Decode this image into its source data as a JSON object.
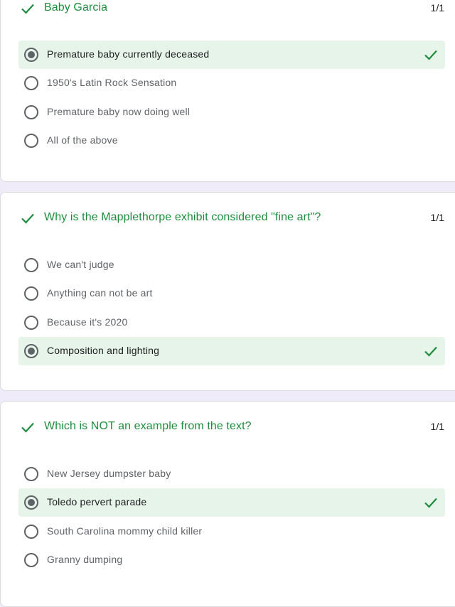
{
  "accent_color": "#1e8e3e",
  "correct_bg_color": "#e6f4ea",
  "questions": [
    {
      "title": "Baby Garcia",
      "score": "1/1",
      "options": [
        {
          "label": "Premature baby currently deceased",
          "selected": true,
          "correct": true
        },
        {
          "label": "1950's Latin Rock Sensation",
          "selected": false,
          "correct": false
        },
        {
          "label": "Premature baby now doing well",
          "selected": false,
          "correct": false
        },
        {
          "label": "All of the above",
          "selected": false,
          "correct": false
        }
      ]
    },
    {
      "title": "Why is the Mapplethorpe exhibit considered \"fine art\"?",
      "score": "1/1",
      "options": [
        {
          "label": "We can't judge",
          "selected": false,
          "correct": false
        },
        {
          "label": "Anything can not be art",
          "selected": false,
          "correct": false
        },
        {
          "label": "Because it's 2020",
          "selected": false,
          "correct": false
        },
        {
          "label": "Composition and lighting",
          "selected": true,
          "correct": true
        }
      ]
    },
    {
      "title": "Which is NOT an example from the text?",
      "score": "1/1",
      "options": [
        {
          "label": "New Jersey dumpster baby",
          "selected": false,
          "correct": false
        },
        {
          "label": "Toledo pervert parade",
          "selected": true,
          "correct": true
        },
        {
          "label": "South Carolina mommy child killer",
          "selected": false,
          "correct": false
        },
        {
          "label": "Granny dumping",
          "selected": false,
          "correct": false
        }
      ]
    }
  ]
}
